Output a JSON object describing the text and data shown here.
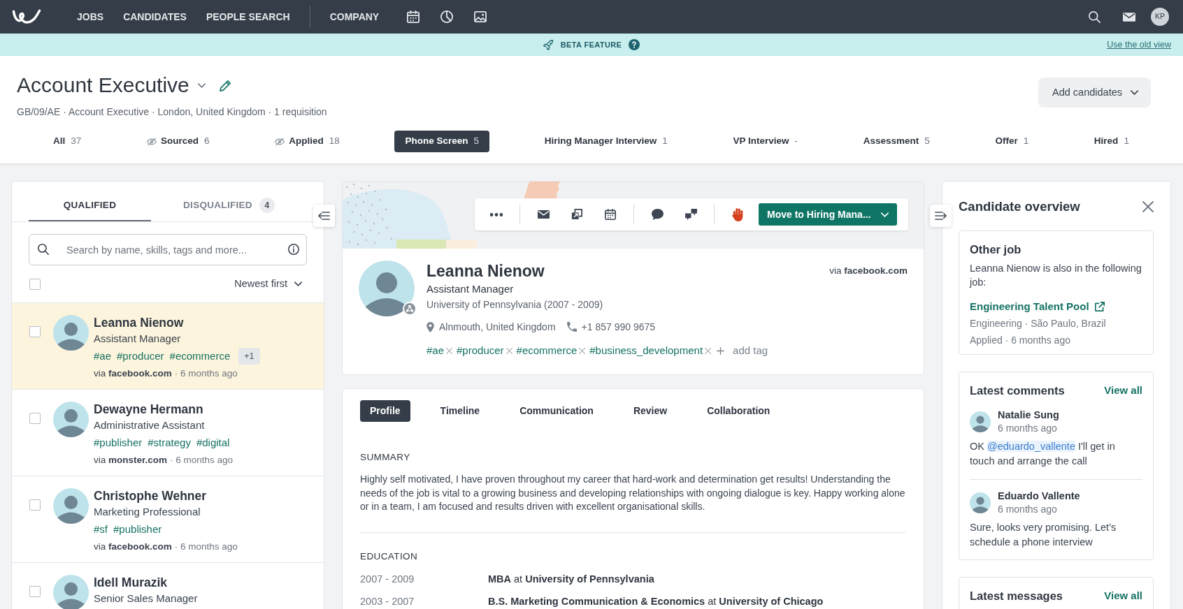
{
  "navbar": {
    "menu_groups": [
      {
        "items": [
          "JOBS",
          "CANDIDATES",
          "PEOPLE SEARCH"
        ]
      },
      {
        "items": [
          "COMPANY"
        ]
      }
    ],
    "avatar": "KP"
  },
  "beta": {
    "label": "BETA FEATURE",
    "link": "Use the old view"
  },
  "job": {
    "title": "Account Executive",
    "meta": "GB/09/AE · Account Executive · London, United Kingdom · 1 requisition",
    "add_button": "Add candidates"
  },
  "stages": [
    {
      "label": "All",
      "count": "37",
      "kind": "plain",
      "selected": false
    },
    {
      "label": "Sourced",
      "count": "6",
      "kind": "hidden",
      "selected": false
    },
    {
      "label": "Applied",
      "count": "18",
      "kind": "hidden",
      "selected": false
    },
    {
      "label": "Phone Screen",
      "count": "5",
      "kind": "plain",
      "selected": true
    },
    {
      "label": "Hiring Manager Interview",
      "count": "1",
      "kind": "plain",
      "selected": false
    },
    {
      "label": "VP Interview",
      "count": "-",
      "kind": "plain",
      "selected": false
    },
    {
      "label": "Assessment",
      "count": "5",
      "kind": "plain",
      "selected": false
    },
    {
      "label": "Offer",
      "count": "1",
      "kind": "plain",
      "selected": false
    },
    {
      "label": "Hired",
      "count": "1",
      "kind": "plain",
      "selected": false
    }
  ],
  "candidate_list": {
    "tabs": [
      {
        "label": "QUALIFIED",
        "selected": true
      },
      {
        "label": "DISQUALIFIED",
        "count": "4",
        "selected": false
      }
    ],
    "search": {
      "placeholder": "Search by name, skills, tags and more..."
    },
    "select_all": {
      "checked": false
    },
    "sort": "Newest first",
    "candidates": [
      {
        "name": "Leanna Nienow",
        "title": "Assistant Manager",
        "tags": [
          "#ae",
          "#producer",
          "#ecommerce"
        ],
        "more_tags": "+1",
        "source": "via **facebook.com**",
        "time": "· 6 months ago",
        "selected": true,
        "checked": false
      },
      {
        "name": "Dewayne Hermann",
        "title": "Administrative Assistant",
        "tags": [
          "#publisher",
          "#strategy",
          "#digital"
        ],
        "source": "via **monster.com**",
        "time": "· 6 months ago",
        "selected": false,
        "checked": false
      },
      {
        "name": "Christophe Wehner",
        "title": "Marketing Professional",
        "tags": [
          "#sf",
          "#publisher"
        ],
        "source": "via **facebook.com**",
        "time": "· 6 months ago",
        "selected": false,
        "checked": false
      },
      {
        "name": "Idell Murazik",
        "title": "Senior Sales Manager",
        "selected": false,
        "checked": false
      }
    ]
  },
  "profile": {
    "move_button": "Move to Hiring Mana...",
    "name": "Leanna Nienow",
    "title": "Assistant Manager",
    "education": "University of Pennsylvania (2007 - 2009)",
    "source": "via **facebook.com**",
    "location": "Alnmouth, United Kingdom",
    "phone": "+1 857 990 9675",
    "tags": [
      "#ae",
      "#producer",
      "#ecommerce",
      "#business_development"
    ],
    "add_tag": "add tag"
  },
  "details": {
    "tabs": [
      {
        "label": "Profile",
        "selected": true
      },
      {
        "label": "Timeline",
        "selected": false
      },
      {
        "label": "Communication",
        "selected": false
      },
      {
        "label": "Review",
        "selected": false
      },
      {
        "label": "Collaboration",
        "selected": false
      }
    ],
    "summary_heading": "SUMMARY",
    "summary": "Highly self motivated, I have proven throughout my career that hard-work and determination get results! Understanding the needs of the job is vital to a growing business and developing relationships with ongoing dialogue is key. Happy working alone or in a team, I am focused and results driven with excellent organisational skills.",
    "education_heading": "EDUCATION",
    "education": [
      {
        "years": "2007 - 2009",
        "degree": "**MBA** at **University of Pennsylvania**"
      },
      {
        "years": "2003 - 2007",
        "degree": "**B.S. Marketing Communication & Economics** at **University of Chicago**"
      }
    ]
  },
  "overview": {
    "title": "Candidate overview",
    "other_job": {
      "heading": "Other job",
      "text": "Leanna Nienow is also in the following job:",
      "link": "Engineering Talent Pool",
      "meta": "Engineering · São Paulo, Brazil",
      "status": "Applied · 6 months ago"
    },
    "comments": {
      "heading": "Latest comments",
      "view_all": "View all",
      "items": [
        {
          "author": "Natalie Sung",
          "time": "6 months ago",
          "body": [
            {
              "kind": "text",
              "text": "OK "
            },
            {
              "kind": "mention",
              "text": "@eduardo_vallente"
            },
            {
              "kind": "text",
              "text": " I'll get in touch and arrange the call"
            }
          ]
        },
        {
          "author": "Eduardo Vallente",
          "time": "6 months ago",
          "body": [
            {
              "kind": "text",
              "text": "Sure, looks very promising. Let’s schedule a phone interview"
            }
          ]
        }
      ]
    },
    "messages": {
      "heading": "Latest messages",
      "view_all": "View all"
    }
  }
}
